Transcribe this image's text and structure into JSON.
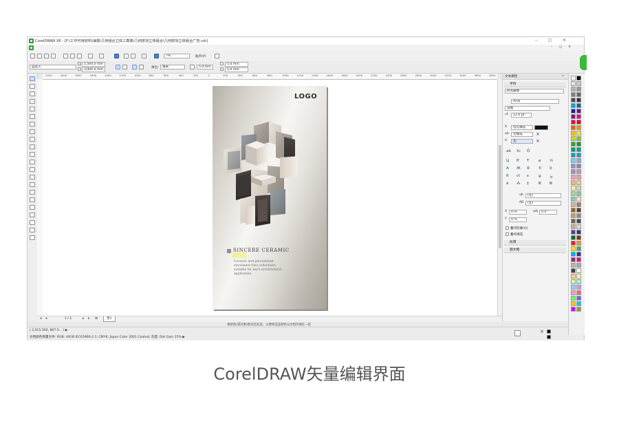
{
  "window": {
    "title": "CorelDRAW X6 - [F:\\工作可用资料\\海报\\几何组合立体三角像\\几何拼块立体组合\\几何拼块立体组合广告.cdr]",
    "controls": [
      "–",
      "◻",
      "×"
    ]
  },
  "toolbar": {
    "zoom": "7%",
    "snap_label": "贴齐(P)",
    "page_size": "自定义",
    "width": "1,500.0 mm",
    "height": "3,000.0 mm",
    "units_label": "单位:",
    "units": "毫米",
    "nudge": "5.0 mm",
    "dup_x": "5.0 mm",
    "dup_y": "5.0 mm"
  },
  "ruler": {
    "ticks": [
      "2200",
      "2000",
      "1800",
      "1600",
      "1400",
      "1200",
      "1000",
      "800",
      "600",
      "400",
      "200",
      "0",
      "200",
      "400",
      "600",
      "800",
      "1000",
      "1200",
      "1400",
      "1600",
      "1800",
      "2000",
      "2200",
      "2400",
      "2600",
      "2800",
      "3000",
      "3200",
      "3400",
      "3600",
      "3800"
    ]
  },
  "poster": {
    "logo": "LOGO",
    "brand": "SINCERE CERAMIC",
    "description": "Ceramic and porcelained stoneware tiles collections suitable for each architectural application."
  },
  "page_nav": {
    "counter": "1 / 1",
    "page_tab": "页1"
  },
  "hint": "将颜色(或对象)拖动至此处，以便将这些颜色与文档存储在一起",
  "status": {
    "coords": "( 2,015.500, 867.5... ) ▶",
    "color_profile": "文档颜色预置文件: RGB: sRGB IEC61966-2.1; CMYK: Japan Color 2001 Coated; 灰度: Dot Gain 15% ▶"
  },
  "panel": {
    "title": "文本属性",
    "char_section": "字符",
    "script": "所有脚本",
    "font": "Arial",
    "style": "常规",
    "size": "12.0 pt",
    "fill_label": "均匀填充",
    "bg_label": "无填充",
    "outline_value": "无",
    "kern_a": "(无)",
    "kern_b": "(无)",
    "x_label": "X",
    "x_value": "0 %",
    "angle_value": "0.0 °",
    "y_label": "Y",
    "y_value": "0 %",
    "check_overprint_outline": "叠印轮廓(O)",
    "check_overprint_fill": "叠印填充",
    "para_section": "段落",
    "frame_section": "图文框"
  },
  "palette_colors": [
    "#ffffff",
    "#000000",
    "#e6e6e6",
    "#cccccc",
    "#b3b3b3",
    "#999999",
    "#808080",
    "#666666",
    "#4d4d4d",
    "#333333",
    "#00a0e9",
    "#0068b7",
    "#1d2088",
    "#601986",
    "#920783",
    "#e4007f",
    "#e5004f",
    "#e60012",
    "#eb6100",
    "#f39800",
    "#fcc800",
    "#fff100",
    "#cfdb00",
    "#8fc31f",
    "#22ac38",
    "#009944",
    "#009b6b",
    "#009e96",
    "#00a0c1",
    "#00a0e9",
    "#7ecef4",
    "#88abda",
    "#8c97cb",
    "#8f82bc",
    "#aa89bd",
    "#c490bf",
    "#f19ec2",
    "#f29c9f",
    "#f6b37f",
    "#facd89",
    "#fff799",
    "#cce198",
    "#acd598",
    "#89c997",
    "#84ccc9",
    "#fce4d6",
    "#d8b48c",
    "#a67c52",
    "#8c6239",
    "#603813",
    "#c69c6d",
    "#998675",
    "#736357",
    "#534741",
    "#c7b299",
    "#e8d7c0",
    "#5e3b8f",
    "#2e3192",
    "#006837",
    "#8c2d04",
    "#ed1c24",
    "#f7941d",
    "#ffde17",
    "#39b54a",
    "#00aeef",
    "#2e3192",
    "#92278f",
    "#ec008c",
    "#c2b59b",
    "#a7a9ac",
    "#414042",
    "#ffffff",
    "#ffcc99",
    "#ffff99",
    "#ccff99",
    "#99ffcc",
    "#99ccff",
    "#cc99ff",
    "#ff99cc",
    "#ff6666",
    "#66ff66",
    "#6666ff",
    "#ffcc00",
    "#00ccff",
    "#cc00ff",
    "#999933"
  ],
  "caption": "CorelDRAW矢量编辑界面"
}
